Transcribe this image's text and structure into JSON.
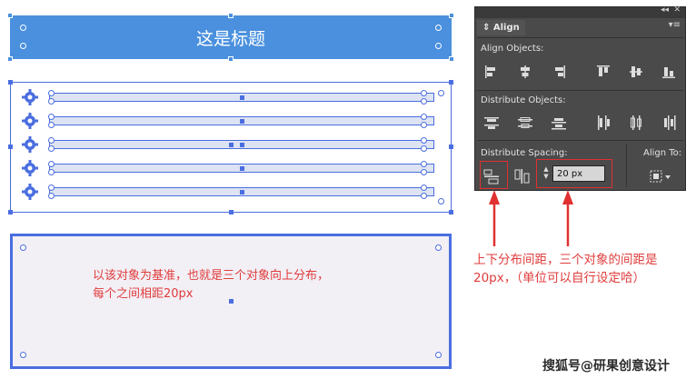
{
  "artboard": {
    "title": "这是标题",
    "panel_text_line1": "以该对象为基准，也就是三个对象向上分布，",
    "panel_text_line2": "每个之间相距20px"
  },
  "align_panel": {
    "collapse_glyph": "◂◂",
    "close_glyph": "✕",
    "tab_label": "Align",
    "menu_glyph": "▾≡",
    "align_objects_label": "Align Objects:",
    "distribute_objects_label": "Distribute Objects:",
    "distribute_spacing_label": "Distribute Spacing:",
    "align_to_label": "Align To:",
    "spacing_value": "20 px",
    "icons": {
      "align_objects": [
        "horizontal-align-left-icon",
        "horizontal-align-center-icon",
        "horizontal-align-right-icon",
        "vertical-align-top-icon",
        "vertical-align-center-icon",
        "vertical-align-bottom-icon"
      ],
      "distribute_objects": [
        "vertical-distribute-top-icon",
        "vertical-distribute-center-icon",
        "vertical-distribute-bottom-icon",
        "horizontal-distribute-left-icon",
        "horizontal-distribute-center-icon",
        "horizontal-distribute-right-icon"
      ]
    },
    "accent_color": "#e03030"
  },
  "annotation": {
    "line1": "上下分布间距，三个对象的间距是",
    "line2": "20px，（单位可以自行设定哈）"
  },
  "watermark": "搜狐号@研果创意设计",
  "colors": {
    "selection_blue": "#4a6ee0",
    "title_fill": "#4a90de",
    "annotation_red": "#e03c3c"
  }
}
